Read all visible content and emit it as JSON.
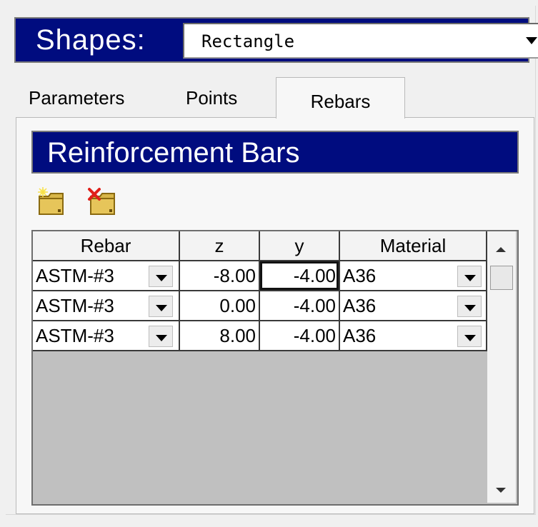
{
  "shapes": {
    "label": "Shapes:",
    "selected": "Rectangle"
  },
  "tabs": [
    {
      "label": "Parameters"
    },
    {
      "label": "Points"
    },
    {
      "label": "Rebars",
      "active": true
    }
  ],
  "section_title": "Reinforcement Bars",
  "toolbar": {
    "add_icon": "add-rebar-folder-icon",
    "delete_icon": "delete-rebar-folder-icon"
  },
  "grid": {
    "columns": [
      "Rebar",
      "z",
      "y",
      "Material"
    ],
    "rows": [
      {
        "rebar": "ASTM-#3",
        "z": "-8.00",
        "y": "-4.00",
        "material": "A36"
      },
      {
        "rebar": "ASTM-#3",
        "z": "0.00",
        "y": "-4.00",
        "material": "A36"
      },
      {
        "rebar": "ASTM-#3",
        "z": "8.00",
        "y": "-4.00",
        "material": "A36"
      }
    ],
    "selected_cell": "row 1, column y"
  },
  "colors": {
    "header_blue": "#000c7f",
    "panel_gray": "#f0f0f0",
    "grid_empty": "#c0c0c0"
  }
}
